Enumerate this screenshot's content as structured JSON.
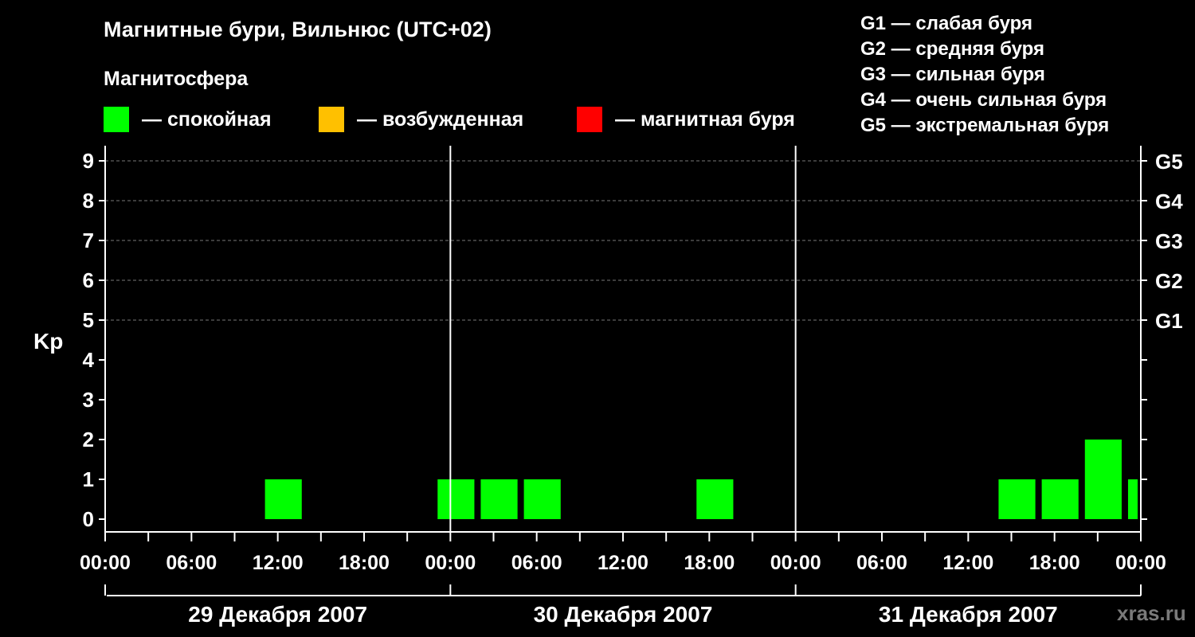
{
  "header": {
    "title": "Магнитные бури, Вильнюс (UTC+02)",
    "subtitle": "Магнитосфера"
  },
  "legend": [
    {
      "label": "— спокойная",
      "color": "#00ff00"
    },
    {
      "label": "— возбужденная",
      "color": "#ffc000"
    },
    {
      "label": "— магнитная буря",
      "color": "#ff0000"
    }
  ],
  "storm_scale": [
    "G1 — слабая буря",
    "G2 — средняя буря",
    "G3 — сильная буря",
    "G4 — очень сильная буря",
    "G5 — экстремальная буря"
  ],
  "watermark": "xras.ru",
  "chart_data": {
    "type": "bar",
    "title": "Магнитные бури, Вильнюс (UTC+02)",
    "ylabel": "Kp",
    "ylim": [
      0,
      9
    ],
    "yticks": [
      "0",
      "1",
      "2",
      "3",
      "4",
      "5",
      "6",
      "7",
      "8",
      "9"
    ],
    "right_ticks": [
      {
        "kp": 5,
        "label": "G1"
      },
      {
        "kp": 6,
        "label": "G2"
      },
      {
        "kp": 7,
        "label": "G3"
      },
      {
        "kp": 8,
        "label": "G4"
      },
      {
        "kp": 9,
        "label": "G5"
      }
    ],
    "xlim_hours": [
      0,
      72
    ],
    "xtick_labels": [
      "00:00",
      "06:00",
      "12:00",
      "18:00",
      "00:00",
      "06:00",
      "12:00",
      "18:00",
      "00:00",
      "06:00",
      "12:00",
      "18:00",
      "00:00"
    ],
    "days": [
      "29 Декабря 2007",
      "30 Декабря 2007",
      "31 Декабря 2007"
    ],
    "grid": true,
    "bars": [
      {
        "start_hour": 11,
        "kp": 1,
        "level": "calm"
      },
      {
        "start_hour": 23,
        "kp": 1,
        "level": "calm"
      },
      {
        "start_hour": 26,
        "kp": 1,
        "level": "calm"
      },
      {
        "start_hour": 29,
        "kp": 1,
        "level": "calm"
      },
      {
        "start_hour": 41,
        "kp": 1,
        "level": "calm"
      },
      {
        "start_hour": 62,
        "kp": 1,
        "level": "calm"
      },
      {
        "start_hour": 65,
        "kp": 1,
        "level": "calm"
      },
      {
        "start_hour": 68,
        "kp": 2,
        "level": "calm"
      },
      {
        "start_hour": 71,
        "kp": 1,
        "level": "calm"
      }
    ],
    "colors": {
      "calm": "#00ff00",
      "active": "#ffc000",
      "storm": "#ff0000"
    }
  }
}
